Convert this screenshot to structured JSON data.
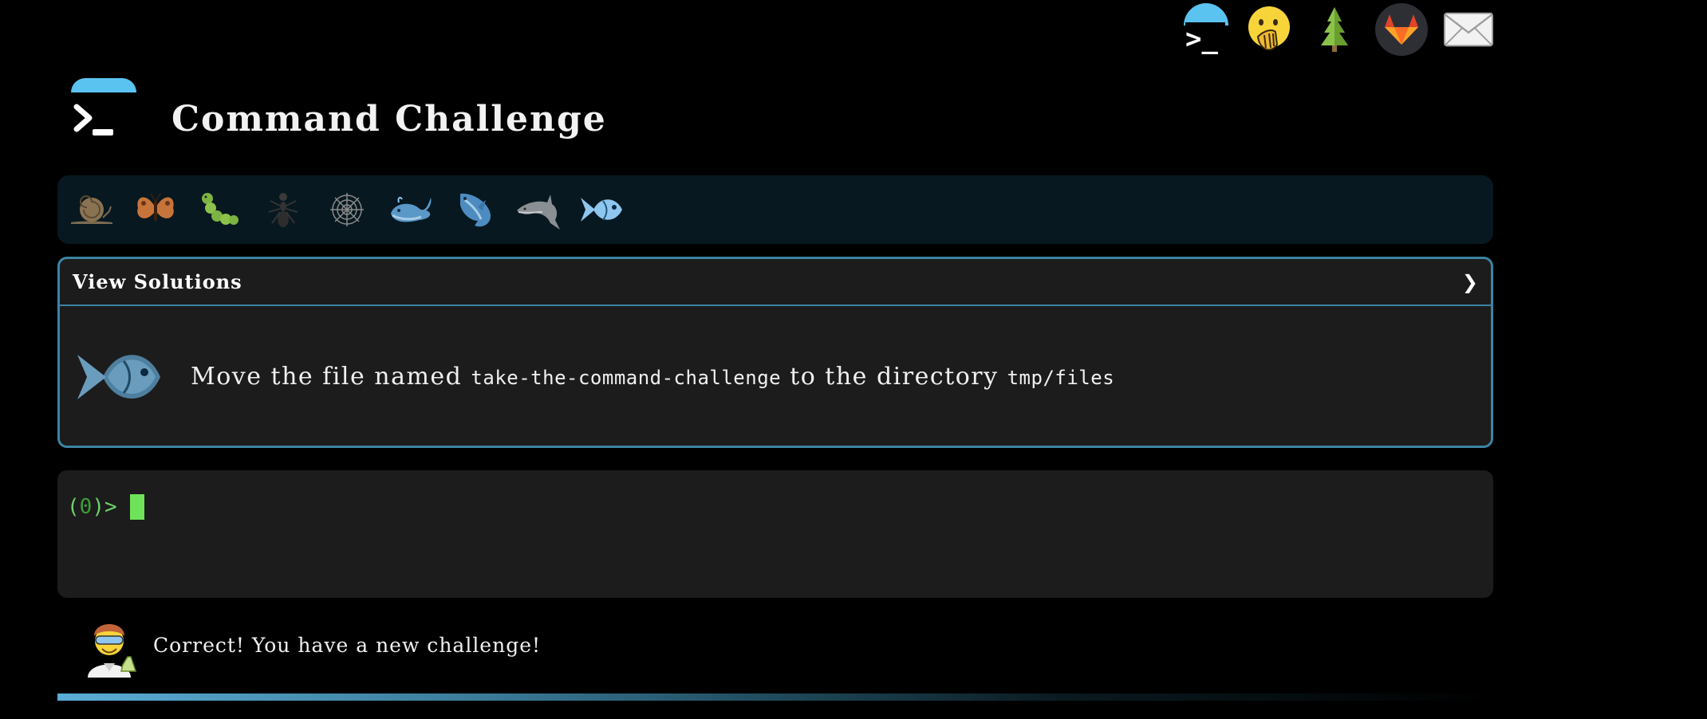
{
  "app": {
    "title": "Command Challenge"
  },
  "topnav": {
    "items": [
      {
        "name": "terminal",
        "glyph": ">_"
      },
      {
        "name": "hand-over-mouth-emoji"
      },
      {
        "name": "tree"
      },
      {
        "name": "gitlab"
      },
      {
        "name": "email"
      }
    ]
  },
  "levels": [
    {
      "name": "snail"
    },
    {
      "name": "butterfly"
    },
    {
      "name": "caterpillar"
    },
    {
      "name": "ant"
    },
    {
      "name": "spider-web"
    },
    {
      "name": "whale"
    },
    {
      "name": "shark"
    },
    {
      "name": "dolphin"
    },
    {
      "name": "fish",
      "active": true
    }
  ],
  "panel": {
    "header": "View Solutions",
    "chevron": "❯",
    "challenge": {
      "prefix": "Move the file named ",
      "file": "take-the-command-challenge",
      "middle": " to the directory ",
      "dir": "tmp/files"
    }
  },
  "terminal": {
    "prompt_open": "(",
    "prompt_num": "0",
    "prompt_close": ")>"
  },
  "feedback": {
    "message": "Correct! You have a new challenge!"
  },
  "progress": {
    "fraction": 1.0
  },
  "colors": {
    "accent": "#5bc3f0",
    "panel_border": "#3d84a3",
    "prompt_green": "#6ed36b",
    "cursor_green": "#6ee35a"
  }
}
